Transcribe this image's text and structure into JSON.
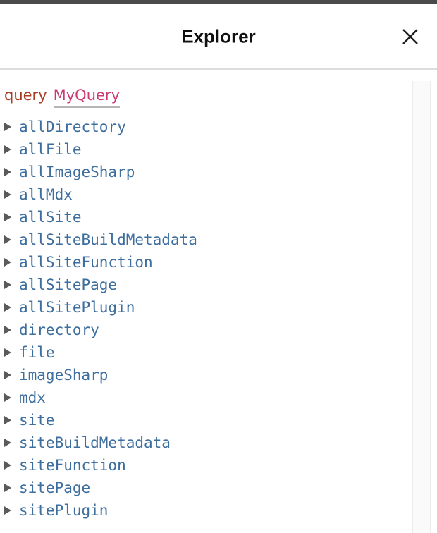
{
  "window": {
    "chrome_bar_color": "#4a4a4a"
  },
  "header": {
    "title": "Explorer",
    "close_icon": "close-icon",
    "title_color": "#111111",
    "border_color": "#dcdcdc"
  },
  "explorer": {
    "query_keyword": "query",
    "query_name": "MyQuery",
    "query_keyword_color": "#a63b22",
    "query_name_color": "#cc3973",
    "query_name_underline_color": "#b6b6b6",
    "field_color": "#3d6e9e",
    "disclosure_icon": "triangle-right-icon",
    "disclosure_color": "#5a5a5a",
    "fields": [
      {
        "name": "allDirectory",
        "expanded": false
      },
      {
        "name": "allFile",
        "expanded": false
      },
      {
        "name": "allImageSharp",
        "expanded": false
      },
      {
        "name": "allMdx",
        "expanded": false
      },
      {
        "name": "allSite",
        "expanded": false
      },
      {
        "name": "allSiteBuildMetadata",
        "expanded": false
      },
      {
        "name": "allSiteFunction",
        "expanded": false
      },
      {
        "name": "allSitePage",
        "expanded": false
      },
      {
        "name": "allSitePlugin",
        "expanded": false
      },
      {
        "name": "directory",
        "expanded": false
      },
      {
        "name": "file",
        "expanded": false
      },
      {
        "name": "imageSharp",
        "expanded": false
      },
      {
        "name": "mdx",
        "expanded": false
      },
      {
        "name": "site",
        "expanded": false
      },
      {
        "name": "siteBuildMetadata",
        "expanded": false
      },
      {
        "name": "siteFunction",
        "expanded": false
      },
      {
        "name": "sitePage",
        "expanded": false
      },
      {
        "name": "sitePlugin",
        "expanded": false
      }
    ]
  },
  "scrollbar": {
    "track_color": "#fafafa",
    "edge_color": "#ececec"
  }
}
